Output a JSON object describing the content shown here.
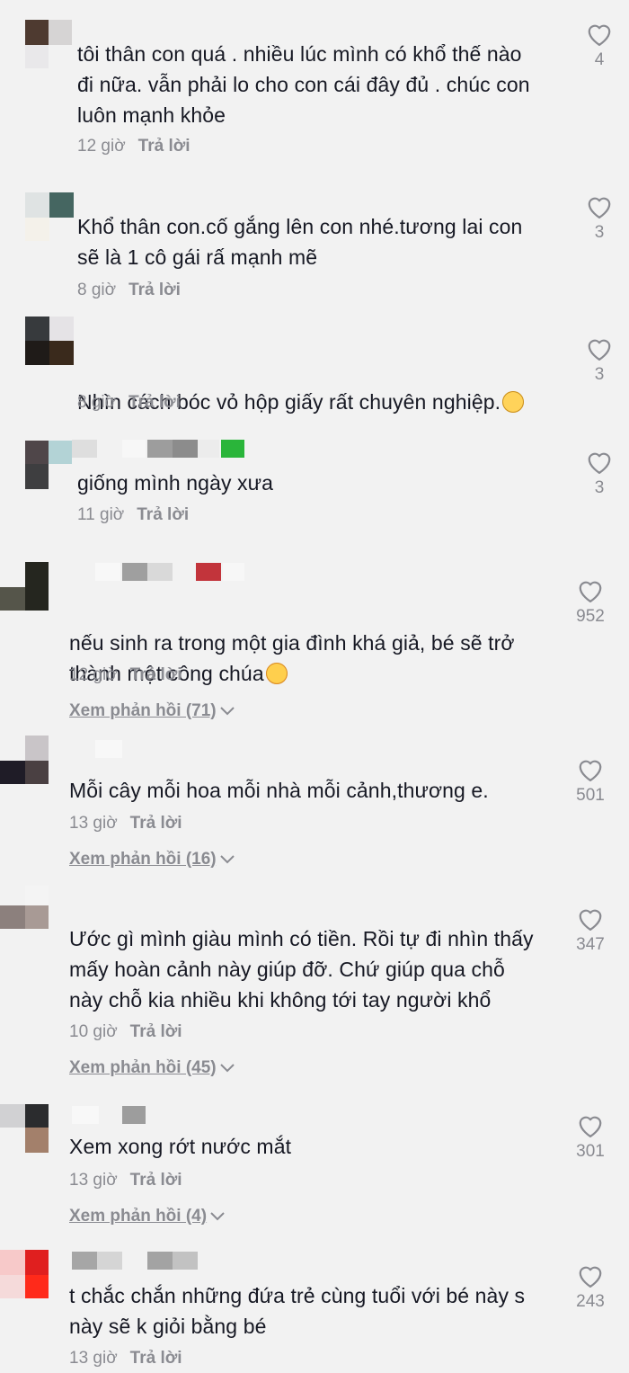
{
  "comments": [
    {
      "text": "tôi thân con quá . nhiều lúc mình có khổ thế nào\nđi nữa. vẫn phải lo cho con cái đây đủ . chúc con\nluôn mạnh khỏe",
      "time": "12 giờ",
      "reply": "Trả lời",
      "likes": "4",
      "view_replies": null
    },
    {
      "text": "Khổ thân con.cố gắng lên con nhé.tương lai con\nsẽ là 1 cô gái rấ mạnh mẽ",
      "time": "8 giờ",
      "reply": "Trả lời",
      "likes": "3",
      "view_replies": null
    },
    {
      "text": "Nhìn cách bóc vỏ hộp giấy rất chuyên nghiệp.",
      "emoji": "pleading-face-emoji",
      "time": "8 giờ",
      "reply": "Trả lời",
      "likes": "3",
      "view_replies": null
    },
    {
      "text": "giống mình ngày xưa",
      "time": "11 giờ",
      "reply": "Trả lời",
      "likes": "3",
      "view_replies": null
    },
    {
      "text": "nếu sinh ra trong một gia đình khá giả, bé sẽ trở\nthành một công chúa",
      "emoji": "smiling-face-with-hearts-emoji",
      "time": "12 giờ",
      "reply": "Trả lời",
      "likes": "952",
      "view_replies": "Xem phản hồi (71)"
    },
    {
      "text": "Mỗi cây mỗi hoa mỗi nhà mỗi cảnh,thương e.",
      "time": "13 giờ",
      "reply": "Trả lời",
      "likes": "501",
      "view_replies": "Xem phản hồi (16)"
    },
    {
      "text": "Ước gì mình giàu mình có tiền. Rồi tự đi nhìn thấy\nmấy hoàn cảnh này giúp đỡ. Chứ giúp qua chỗ\nnày chỗ kia nhiều khi không tới tay người khổ",
      "time": "10 giờ",
      "reply": "Trả lời",
      "likes": "347",
      "view_replies": "Xem phản hồi (45)"
    },
    {
      "text": "Xem xong rớt nước mắt",
      "time": "13 giờ",
      "reply": "Trả lời",
      "likes": "301",
      "view_replies": "Xem phản hồi (4)"
    },
    {
      "text": "t chắc chắn những đứa trẻ cùng tuổi với bé này s\nnày sẽ k giỏi bằng bé",
      "time": "13 giờ",
      "reply": "Trả lời",
      "likes": "243",
      "view_replies": null
    }
  ],
  "colors": {
    "text": "#161823",
    "muted": "#8a8b91",
    "background": "#f2f2f2"
  }
}
